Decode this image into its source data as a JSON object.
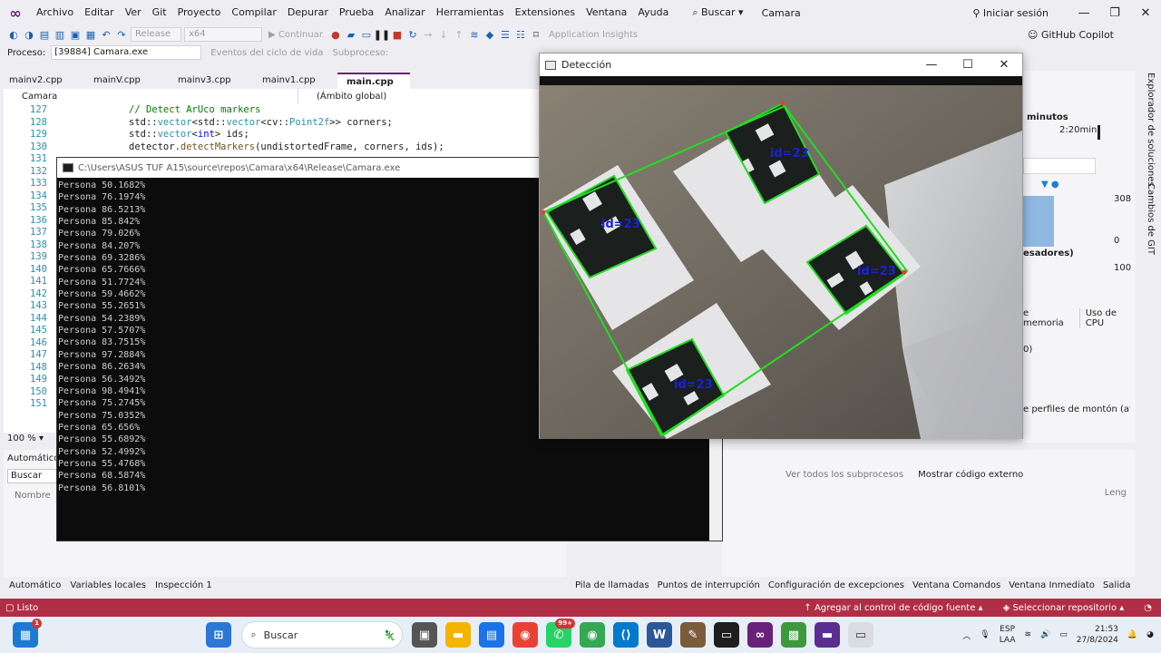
{
  "menubar": {
    "items": [
      "Archivo",
      "Editar",
      "Ver",
      "Git",
      "Proyecto",
      "Compilar",
      "Depurar",
      "Prueba",
      "Analizar",
      "Herramientas",
      "Extensiones",
      "Ventana",
      "Ayuda"
    ],
    "search_label": "Buscar",
    "project_title": "Camara",
    "signin_label": "Iniciar sesión"
  },
  "toolbar": {
    "config_value": "Release",
    "platform_value": "x64",
    "continue_label": "Continuar",
    "app_insights_label": "Application Insights",
    "copilot_label": "GitHub Copilot"
  },
  "procbar": {
    "label": "Proceso:",
    "value": "[39884] Camara.exe",
    "events_label": "Eventos del ciclo de vida",
    "subprocess_label": "Subproceso:"
  },
  "tabs": [
    "mainv2.cpp",
    "mainV.cpp",
    "mainv3.cpp",
    "mainv1.cpp",
    "main.cpp"
  ],
  "scope": {
    "left": "Camara",
    "right": "(Ámbito global)"
  },
  "code_lines": [
    {
      "n": "127",
      "parts": [
        {
          "t": "// Detect ArUco markers",
          "c": "cm"
        }
      ]
    },
    {
      "n": "128",
      "parts": [
        {
          "t": "std::",
          "c": ""
        },
        {
          "t": "vector",
          "c": "ty"
        },
        {
          "t": "<std::",
          "c": ""
        },
        {
          "t": "vector",
          "c": "ty"
        },
        {
          "t": "<cv::",
          "c": ""
        },
        {
          "t": "Point2f",
          "c": "ty"
        },
        {
          "t": ">> corners;",
          "c": ""
        }
      ]
    },
    {
      "n": "129",
      "parts": [
        {
          "t": "std::",
          "c": ""
        },
        {
          "t": "vector",
          "c": "ty"
        },
        {
          "t": "<",
          "c": ""
        },
        {
          "t": "int",
          "c": "kw"
        },
        {
          "t": "> ids;",
          "c": ""
        }
      ]
    },
    {
      "n": "130",
      "parts": [
        {
          "t": "detector.",
          "c": ""
        },
        {
          "t": "detectMarkers",
          "c": "fn"
        },
        {
          "t": "(undistortedFrame, corners, ids);",
          "c": ""
        }
      ]
    },
    {
      "n": "131",
      "parts": []
    },
    {
      "n": "132",
      "parts": []
    },
    {
      "n": "133",
      "parts": []
    },
    {
      "n": "134",
      "parts": []
    },
    {
      "n": "135",
      "parts": []
    },
    {
      "n": "136",
      "parts": []
    },
    {
      "n": "137",
      "parts": []
    },
    {
      "n": "138",
      "parts": []
    },
    {
      "n": "139",
      "parts": []
    },
    {
      "n": "140",
      "parts": []
    },
    {
      "n": "141",
      "parts": []
    },
    {
      "n": "142",
      "parts": []
    },
    {
      "n": "143",
      "parts": []
    },
    {
      "n": "144",
      "parts": []
    },
    {
      "n": "145",
      "parts": []
    },
    {
      "n": "146",
      "parts": []
    },
    {
      "n": "147",
      "parts": []
    },
    {
      "n": "148",
      "parts": []
    },
    {
      "n": "149",
      "parts": []
    },
    {
      "n": "150",
      "parts": []
    },
    {
      "n": "151",
      "parts": []
    }
  ],
  "zoom": "100 %",
  "console": {
    "title": "C:\\Users\\ASUS TUF A15\\source\\repos\\Camara\\x64\\Release\\Camara.exe",
    "lines": [
      "Persona 50.1682%",
      "Persona 76.1974%",
      "Persona 86.5213%",
      "Persona 85.842%",
      "Persona 79.026%",
      "Persona 84.207%",
      "Persona 69.3286%",
      "Persona 65.7666%",
      "Persona 51.7724%",
      "Persona 59.4662%",
      "Persona 55.2651%",
      "Persona 54.2389%",
      "Persona 57.5707%",
      "Persona 83.7515%",
      "Persona 97.2884%",
      "Persona 86.2634%",
      "Persona 56.3492%",
      "Persona 98.4941%",
      "Persona 75.2745%",
      "Persona 75.0352%",
      "Persona 65.656%",
      "Persona 55.6892%",
      "Persona 52.4992%",
      "Persona 55.4768%",
      "Persona 68.5874%",
      "Persona 56.8101%"
    ]
  },
  "detection": {
    "title": "Detección",
    "marker_labels": [
      "id=23",
      "id=23",
      "id=23",
      "id=23"
    ],
    "colors": {
      "box": "#22dd22",
      "label": "#1a22d8"
    }
  },
  "autos": {
    "title": "Automático",
    "search_placeholder": "Buscar (Ctrl",
    "col_name": "Nombre"
  },
  "bottom_left_tabs": [
    "Automático",
    "Variables locales",
    "Inspección 1"
  ],
  "bottom_right_tabs": [
    "Pila de llamadas",
    "Puntos de interrupción",
    "Configuración de excepciones",
    "Ventana Comandos",
    "Ventana Inmediato",
    "Salida"
  ],
  "callstack": {
    "show_all_label": "Ver todos los subprocesos",
    "external_label": "Mostrar código externo",
    "lang_col": "Leng"
  },
  "diag": {
    "minutes": "minutos",
    "time": "2:20min",
    "v308": "308",
    "v0": "0",
    "processors": "esadores)",
    "v100": "100",
    "mem_tab": "e memoria",
    "cpu_tab": "Uso de CPU",
    "paren": "0)",
    "heap": "e perfiles de montón (afe"
  },
  "right_rail": {
    "explorer": "Explorador de soluciones",
    "git": "Cambios de GIT"
  },
  "statusbar": {
    "ready": "Listo",
    "add_src": "Agregar al control de código fuente",
    "select_repo": "Seleccionar repositorio"
  },
  "taskbar": {
    "search": "Buscar",
    "lang1": "ESP",
    "lang2": "LAA",
    "time": "21:53",
    "date": "27/8/2024",
    "badge_whatsapp": "99+",
    "badge_widgets": "1"
  }
}
